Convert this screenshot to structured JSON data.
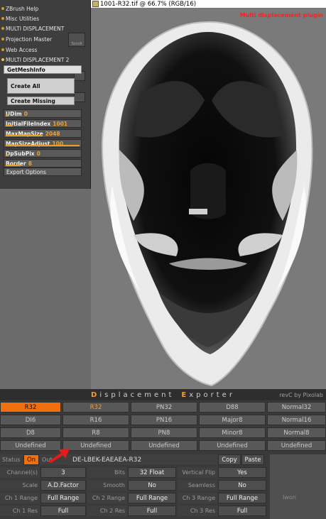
{
  "document": {
    "title": "1001-R32.tif @ 66.7% (RGB/16)",
    "caption": "Multi displacement plugin"
  },
  "palette": {
    "menu": [
      {
        "label": "ZBrush Help"
      },
      {
        "label": "Misc Utilities"
      },
      {
        "label": "MULTI DISPLACEMENT"
      },
      {
        "label": "Projection Master"
      },
      {
        "label": "Web Access"
      },
      {
        "label": "MULTI DISPLACEMENT 2"
      }
    ],
    "get_mesh_info": "GetMeshInfo",
    "create_all": "Create All",
    "create_missing": "Create Missing",
    "side_button": "Scroll",
    "sliders": [
      {
        "label": "UDim",
        "value": "0",
        "fill": 0.0
      },
      {
        "label": "InitialFileIndex",
        "value": "1001",
        "fill": 0.1
      },
      {
        "label": "MaxMapSize",
        "value": "2048",
        "fill": 0.5
      },
      {
        "label": "MapSizeAdjust",
        "value": "100",
        "fill": 1.0
      },
      {
        "label": "DpSubPix",
        "value": "0",
        "fill": 0.0
      },
      {
        "label": "Border",
        "value": "8",
        "fill": 0.2
      }
    ],
    "export_options": "Export Options"
  },
  "exporter": {
    "title_accent_1": "D",
    "title_mid_1": "isplacement",
    "title_accent_2": "E",
    "title_mid_2": "xporter",
    "byline": "revC by Pixolab",
    "formats": [
      [
        "R32",
        "R32",
        "PN32",
        "D88",
        "Normal32"
      ],
      [
        "DI6",
        "R16",
        "PN16",
        "Major8",
        "Normal16"
      ],
      [
        "D8",
        "R8",
        "PN8",
        "Minor8",
        "Normal8"
      ],
      [
        "Undefined",
        "Undefined",
        "Undefined",
        "Undefined",
        "Undefined"
      ]
    ],
    "status_label": "Status",
    "status_value": "On",
    "out_label": "Out",
    "code": "DE-LBEK-EAEAEA-R32",
    "copy": "Copy",
    "paste": "Paste",
    "rows": [
      {
        "l1": "Channel(s)",
        "v1": "3",
        "l2": "Bits",
        "v2": "32 Float",
        "l3": "Vertical Flip",
        "v3": "Yes"
      },
      {
        "l1": "Scale",
        "v1": "A.D.Factor",
        "l2": "Smooth",
        "v2": "No",
        "l3": "Seamless",
        "v3": "No"
      },
      {
        "l1": "Ch 1 Range",
        "v1": "Full Range",
        "l2": "Ch 2 Range",
        "v2": "Full Range",
        "l3": "Ch 3 Range",
        "v3": "Full Range"
      },
      {
        "l1": "Ch 1 Res",
        "v1": "Full",
        "l2": "Ch 2 Res",
        "v2": "Full",
        "l3": "Ch 3 Res",
        "v3": "Full"
      }
    ],
    "side_text": "Iwon"
  },
  "colors": {
    "accent": "#f07010",
    "value": "#f0a030"
  }
}
